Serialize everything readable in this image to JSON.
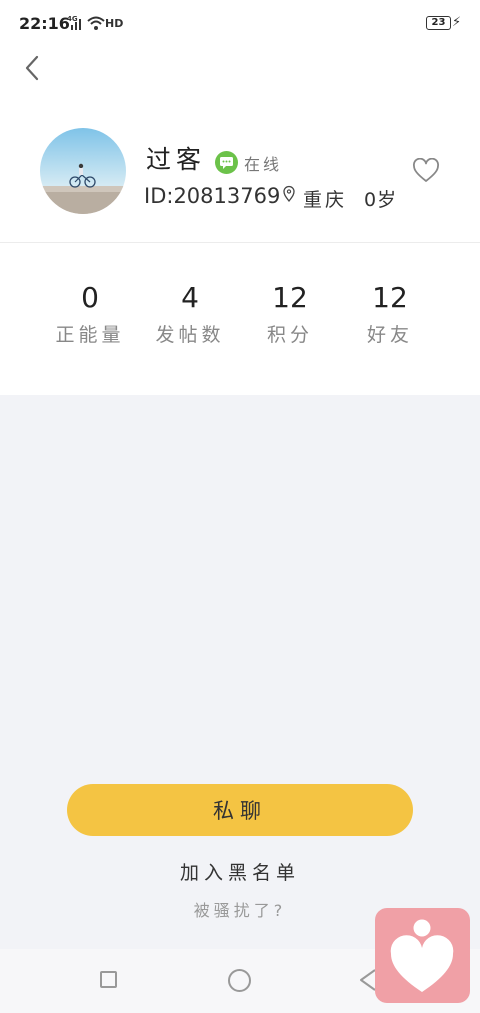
{
  "status_bar": {
    "time": "22:16",
    "network": "4G",
    "hd_label": "HD",
    "battery": "23"
  },
  "profile": {
    "name": "过客",
    "online_status": "在线",
    "id_label": "ID:20813769",
    "city": "重庆",
    "age": "0岁"
  },
  "stats": [
    {
      "value": "0",
      "label": "正能量"
    },
    {
      "value": "4",
      "label": "发帖数"
    },
    {
      "value": "12",
      "label": "积分"
    },
    {
      "value": "12",
      "label": "好友"
    }
  ],
  "actions": {
    "chat_button": "私聊",
    "blacklist": "加入黑名单",
    "harass_hint": "被骚扰了?"
  },
  "colors": {
    "accent_yellow": "#f4c443",
    "online_green": "#6cc24a",
    "float_pink": "#f0a0a6"
  },
  "icons": [
    "back-arrow-icon",
    "chat-bubble-icon",
    "location-pin-icon",
    "heart-outline-icon",
    "home-circle-icon",
    "recent-apps-icon",
    "nav-back-icon",
    "heart-app-icon"
  ]
}
